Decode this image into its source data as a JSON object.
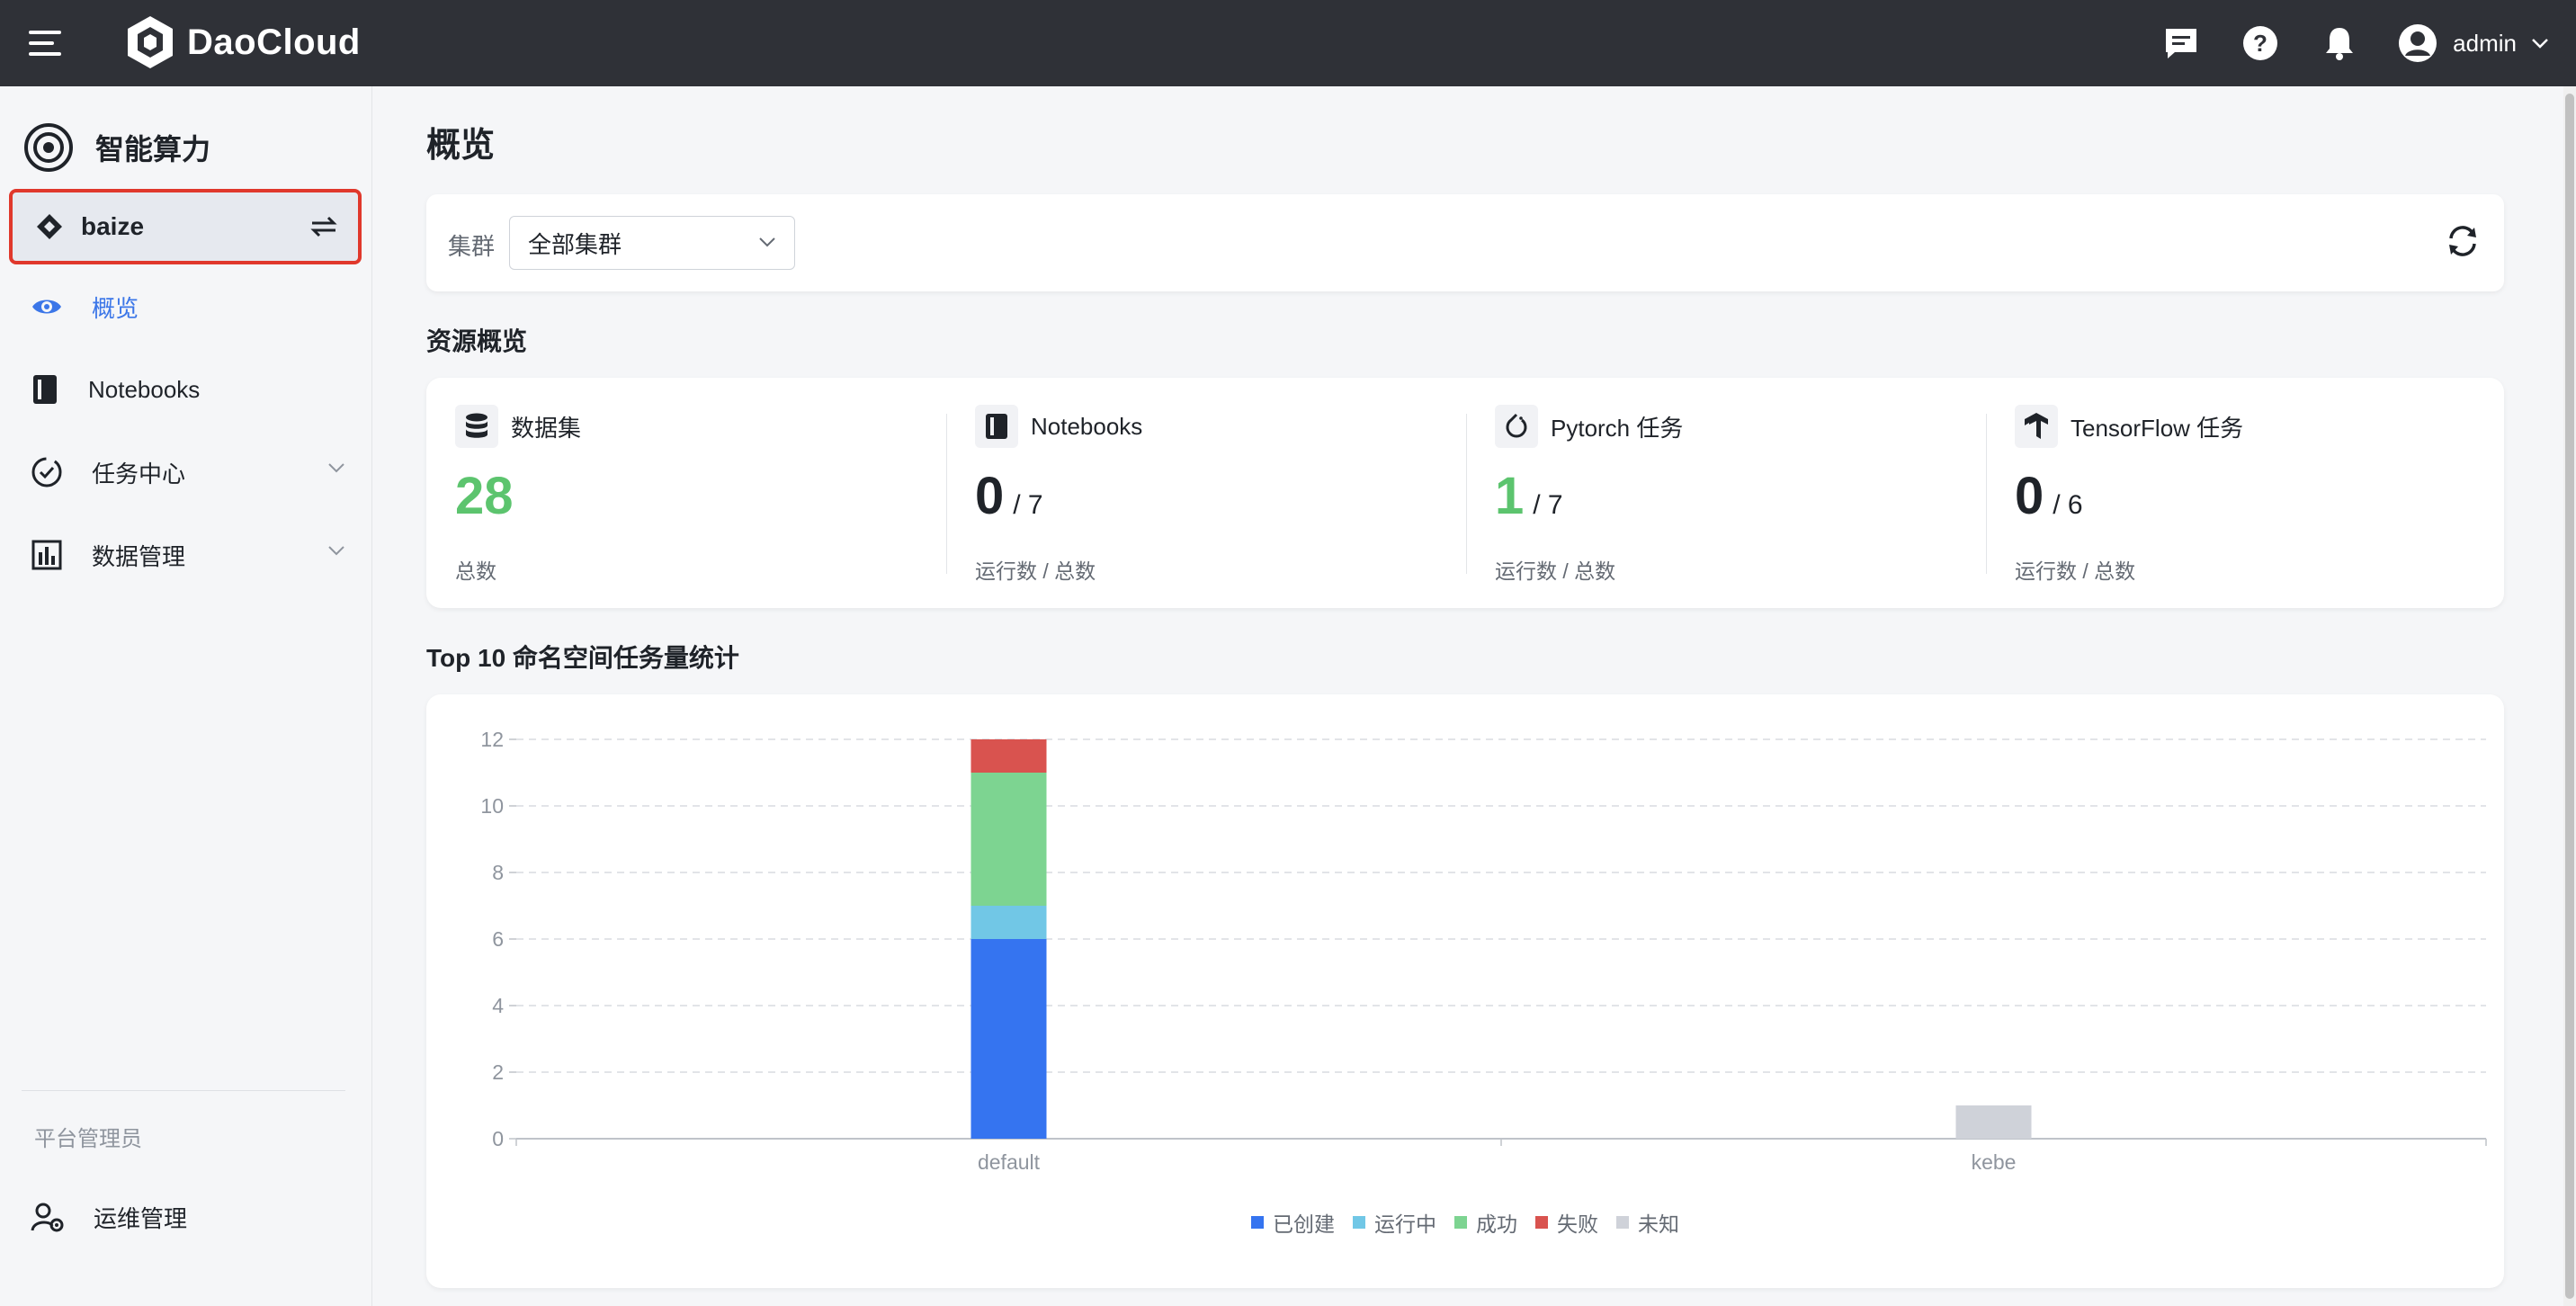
{
  "topbar": {
    "brand": "DaoCloud",
    "user": "admin"
  },
  "sidebar": {
    "module_title": "智能算力",
    "workspace": "baize",
    "items": [
      {
        "label": "概览",
        "active": true
      },
      {
        "label": "Notebooks"
      },
      {
        "label": "任务中心",
        "expandable": true
      },
      {
        "label": "数据管理",
        "expandable": true
      }
    ],
    "role_label": "平台管理员",
    "admin_item": "运维管理"
  },
  "main": {
    "title": "概览",
    "filter": {
      "label": "集群",
      "selected": "全部集群"
    },
    "resources_title": "资源概览",
    "stats": [
      {
        "name": "数据集",
        "value": "28",
        "footer": "总数",
        "icon": "database-icon"
      },
      {
        "name": "Notebooks",
        "value": "0",
        "total": "/ 7",
        "footer": "运行数 / 总数",
        "icon": "notebook-icon"
      },
      {
        "name": "Pytorch 任务",
        "value": "1",
        "total": "/ 7",
        "footer": "运行数 / 总数",
        "icon": "pytorch-icon"
      },
      {
        "name": "TensorFlow 任务",
        "value": "0",
        "total": "/ 6",
        "footer": "运行数 / 总数",
        "icon": "tensorflow-icon"
      }
    ],
    "chart_title": "Top 10 命名空间任务量统计"
  },
  "colors": {
    "accent": "#3b76e8",
    "green": "#5cc46e",
    "highlight_border": "#e0382c"
  },
  "chart_data": {
    "type": "bar",
    "stacked": true,
    "categories": [
      "default",
      "kebe"
    ],
    "series": [
      {
        "name": "已创建",
        "color": "#3574f0",
        "values": [
          6,
          0
        ]
      },
      {
        "name": "运行中",
        "color": "#71c7e6",
        "values": [
          1,
          0
        ]
      },
      {
        "name": "成功",
        "color": "#7dd491",
        "values": [
          4,
          0
        ]
      },
      {
        "name": "失败",
        "color": "#d9534f",
        "values": [
          1,
          0
        ]
      },
      {
        "name": "未知",
        "color": "#cfd2d9",
        "values": [
          0,
          1
        ]
      }
    ],
    "yticks": [
      "0",
      "2",
      "4",
      "6",
      "8",
      "10",
      "12"
    ],
    "ylim": [
      0,
      12
    ],
    "grid": true,
    "legend_position": "bottom-center"
  }
}
